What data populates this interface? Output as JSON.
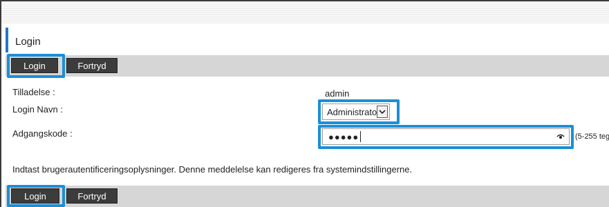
{
  "header": {
    "title": "Login"
  },
  "toolbar_top": {
    "login_label": "Login",
    "cancel_label": "Fortryd"
  },
  "toolbar_bottom": {
    "login_label": "Login",
    "cancel_label": "Fortryd"
  },
  "form": {
    "permission": {
      "label": "Tilladelse :",
      "value": "admin"
    },
    "login_name": {
      "label": "Login Navn :",
      "selected": "Administrator"
    },
    "password": {
      "label": "Adgangskode :",
      "masked_value": "●●●●●",
      "hint": "(5-255 teg"
    }
  },
  "message": "Indtast brugerautentificeringsoplysninger. Denne meddelelse kan redigeres fra systemindstillingerne.",
  "colors": {
    "highlight": "#1a8fd6",
    "title_accent": "#1f78c8",
    "button_bg": "#3c3c3c",
    "toolbar_bg": "#d6d6d6"
  },
  "icons": {
    "dropdown": "chevron-down-icon",
    "password_toggle": "eye-icon"
  }
}
